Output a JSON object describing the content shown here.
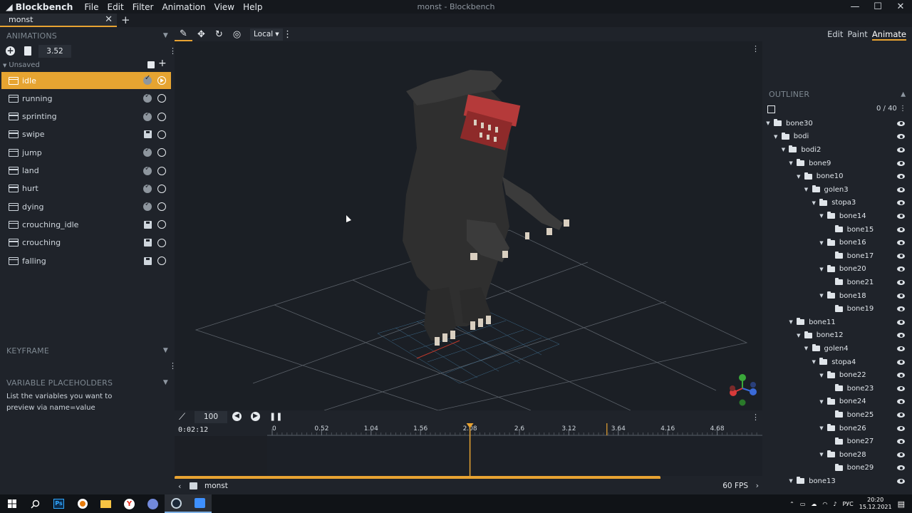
{
  "window": {
    "app_name": "Blockbench",
    "title": "monst - Blockbench",
    "minimize": "—",
    "maximize": "☐",
    "close": "✕"
  },
  "menu": [
    "File",
    "Edit",
    "Filter",
    "Animation",
    "View",
    "Help"
  ],
  "tab": {
    "label": "monst",
    "close": "✕",
    "add": "+"
  },
  "animations_panel": {
    "title": "ANIMATIONS",
    "time_value": "3.52",
    "group": "Unsaved",
    "items": [
      {
        "name": "idle",
        "selected": true,
        "status": "check"
      },
      {
        "name": "running",
        "status": "check"
      },
      {
        "name": "sprinting",
        "status": "check"
      },
      {
        "name": "swipe",
        "status": "save"
      },
      {
        "name": "jump",
        "status": "check"
      },
      {
        "name": "land",
        "status": "check"
      },
      {
        "name": "hurt",
        "status": "check"
      },
      {
        "name": "dying",
        "status": "check"
      },
      {
        "name": "crouching_idle",
        "status": "save"
      },
      {
        "name": "crouching",
        "status": "save"
      },
      {
        "name": "falling",
        "status": "save"
      }
    ]
  },
  "keyframe_panel": {
    "title": "KEYFRAME"
  },
  "placeholders_panel": {
    "title": "VARIABLE PLACEHOLDERS",
    "text": "List the variables you want to preview via name=value"
  },
  "toolbar": {
    "space": "Local",
    "icons": [
      "animation-tool-icon",
      "move-icon",
      "rotate-icon",
      "pivot-icon"
    ]
  },
  "modes": {
    "items": [
      "Edit",
      "Paint",
      "Animate"
    ],
    "active": "Animate"
  },
  "outliner": {
    "title": "OUTLINER",
    "count": "0 / 40",
    "nodes": [
      {
        "name": "bone30",
        "depth": 0,
        "expanded": true
      },
      {
        "name": "bodi",
        "depth": 1,
        "expanded": true
      },
      {
        "name": "bodi2",
        "depth": 2,
        "expanded": true
      },
      {
        "name": "bone9",
        "depth": 3,
        "expanded": true
      },
      {
        "name": "bone10",
        "depth": 4,
        "expanded": true
      },
      {
        "name": "golen3",
        "depth": 5,
        "expanded": true
      },
      {
        "name": "stopa3",
        "depth": 6,
        "expanded": true
      },
      {
        "name": "bone14",
        "depth": 7,
        "expanded": true
      },
      {
        "name": "bone15",
        "depth": 8,
        "expanded": false
      },
      {
        "name": "bone16",
        "depth": 7,
        "expanded": true
      },
      {
        "name": "bone17",
        "depth": 8,
        "expanded": false
      },
      {
        "name": "bone20",
        "depth": 7,
        "expanded": true
      },
      {
        "name": "bone21",
        "depth": 8,
        "expanded": false
      },
      {
        "name": "bone18",
        "depth": 7,
        "expanded": true
      },
      {
        "name": "bone19",
        "depth": 8,
        "expanded": false
      },
      {
        "name": "bone11",
        "depth": 3,
        "expanded": true
      },
      {
        "name": "bone12",
        "depth": 4,
        "expanded": true
      },
      {
        "name": "golen4",
        "depth": 5,
        "expanded": true
      },
      {
        "name": "stopa4",
        "depth": 6,
        "expanded": true
      },
      {
        "name": "bone22",
        "depth": 7,
        "expanded": true
      },
      {
        "name": "bone23",
        "depth": 8,
        "expanded": false
      },
      {
        "name": "bone24",
        "depth": 7,
        "expanded": true
      },
      {
        "name": "bone25",
        "depth": 8,
        "expanded": false
      },
      {
        "name": "bone26",
        "depth": 7,
        "expanded": true
      },
      {
        "name": "bone27",
        "depth": 8,
        "expanded": false
      },
      {
        "name": "bone28",
        "depth": 7,
        "expanded": true
      },
      {
        "name": "bone29",
        "depth": 8,
        "expanded": false
      },
      {
        "name": "bone13",
        "depth": 3,
        "expanded": true
      }
    ]
  },
  "timeline": {
    "speed": "100",
    "timecode": "0:02:12",
    "ticks": [
      "0",
      "0.52",
      "1.04",
      "1.56",
      "2.08",
      "2.6",
      "3.12",
      "3.64",
      "4.16",
      "4.68"
    ],
    "playhead": 2.08,
    "end_marker": 3.52
  },
  "status": {
    "model": "monst",
    "fps": "60 FPS"
  },
  "taskbar": {
    "time": "20:20",
    "date": "15.12.2021",
    "lang": "РУС"
  },
  "colors": {
    "accent": "#e8a332",
    "panel": "#1f232a",
    "viewport": "#1b1f25"
  }
}
